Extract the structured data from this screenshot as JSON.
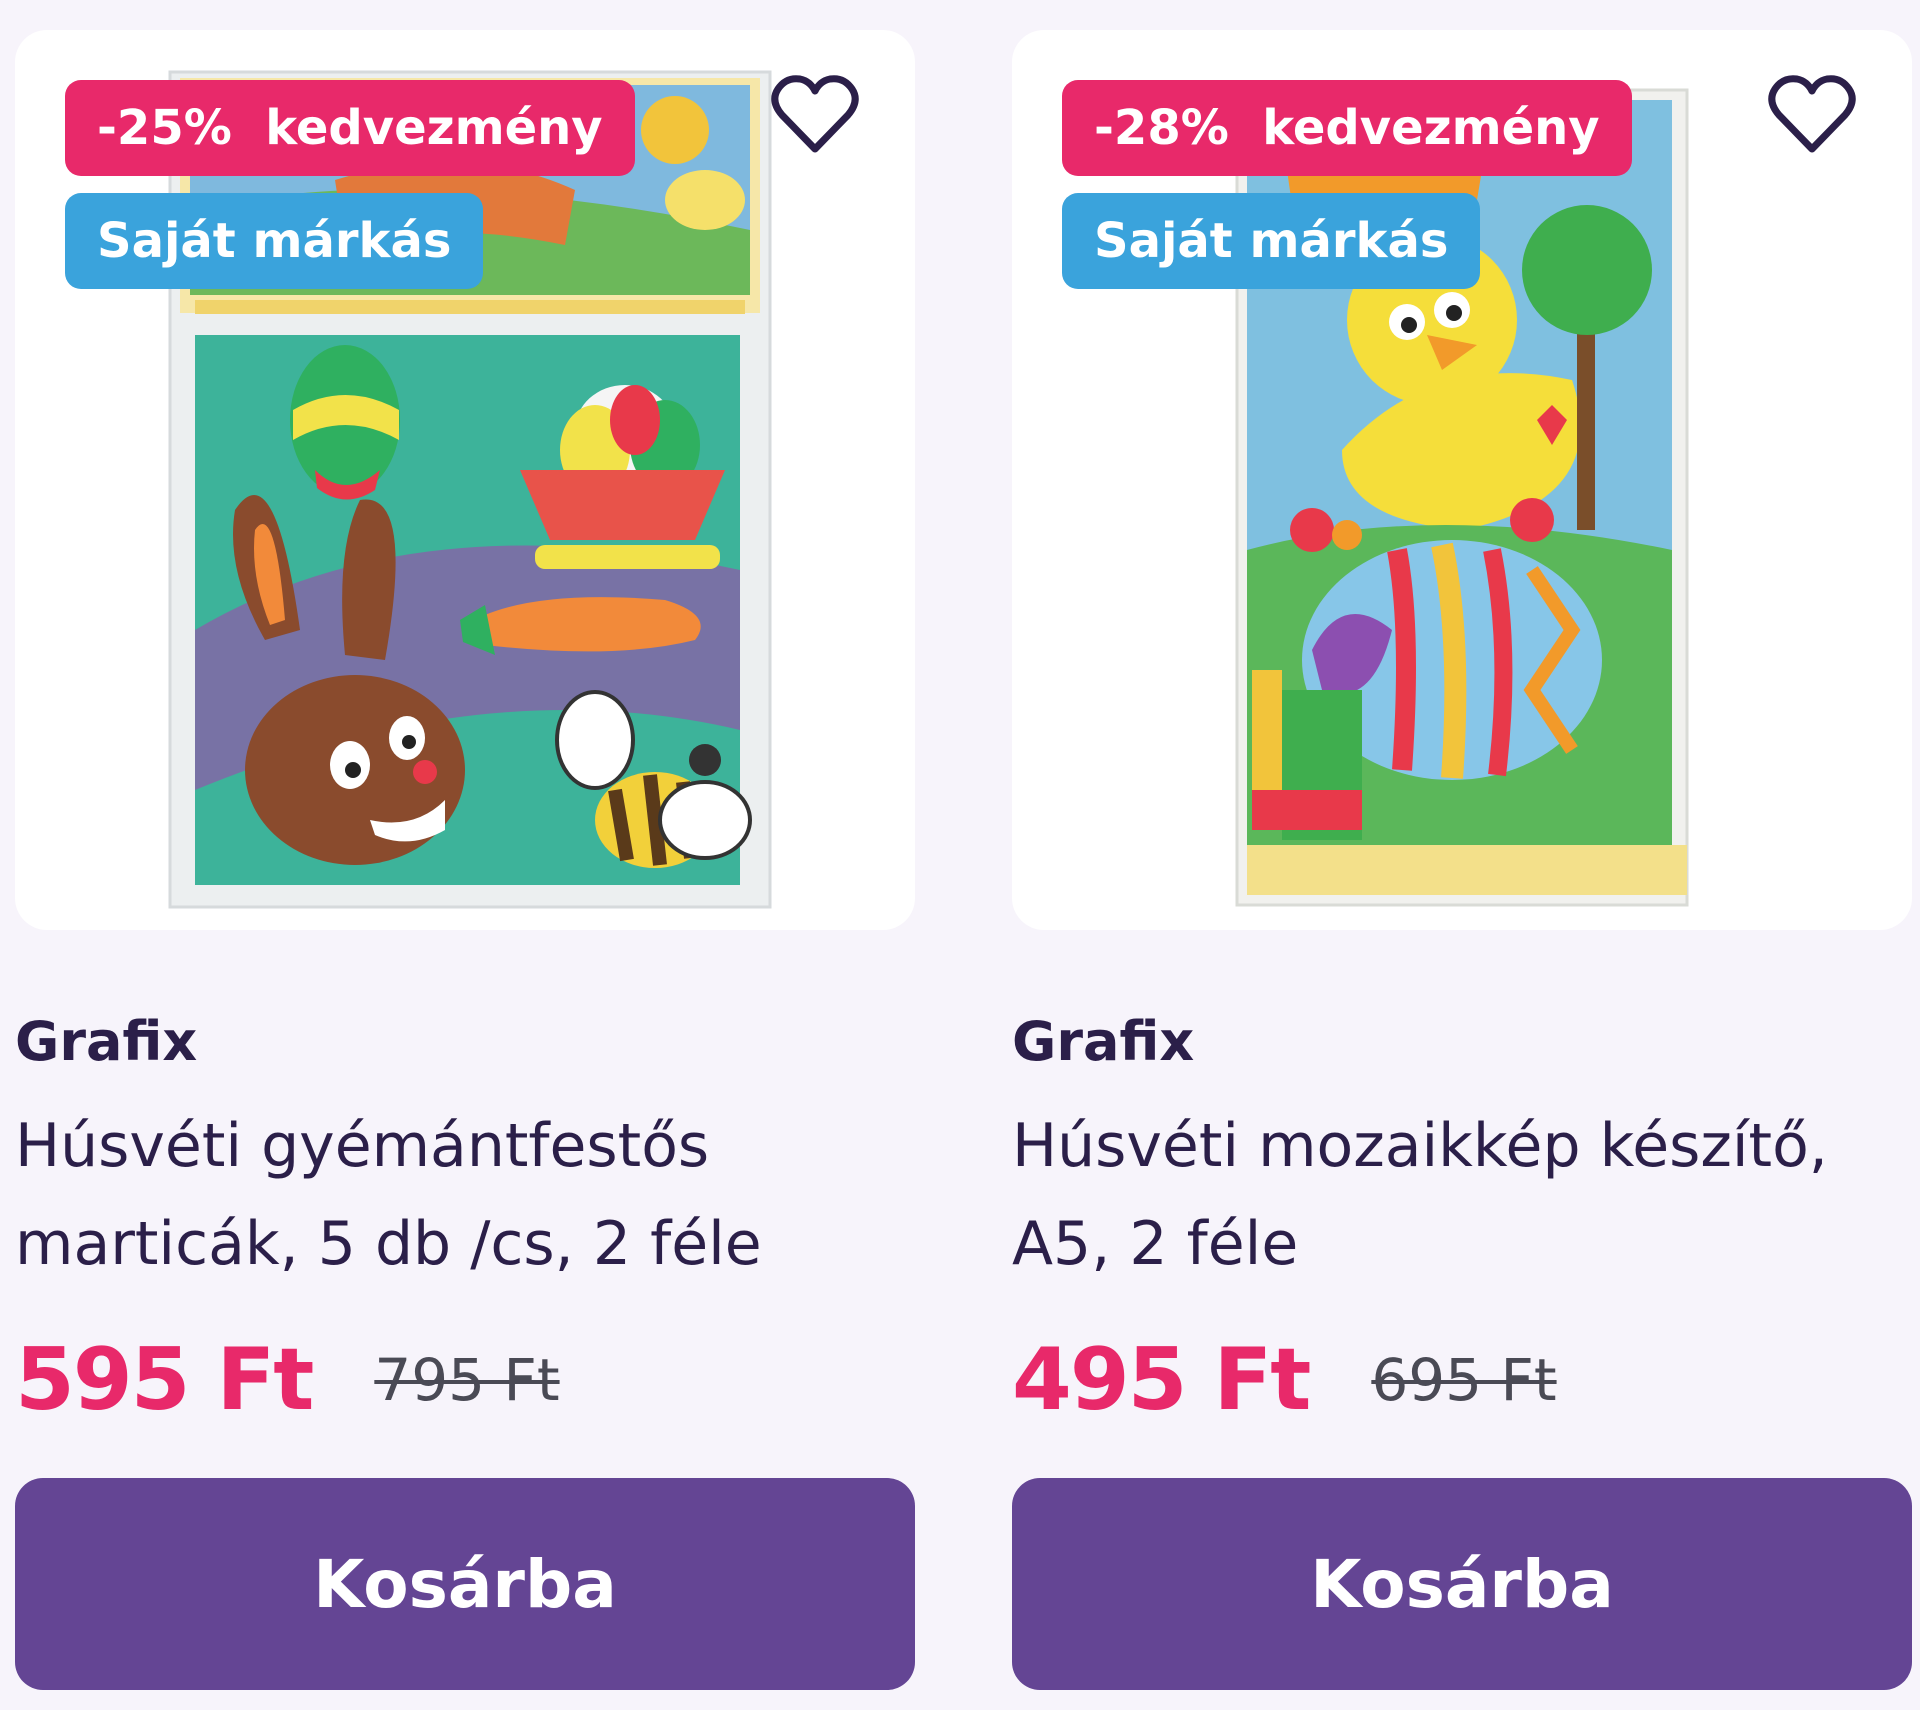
{
  "colors": {
    "background": "#f7f4fb",
    "discount_badge": "#e8296a",
    "brand_badge": "#3aa3dc",
    "price": "#e8296a",
    "cart_button": "#644594",
    "text": "#2b1f49"
  },
  "products": [
    {
      "discount_badge": "-25%  kedvezmény",
      "brand_badge": "Saját márkás",
      "wishlist_icon": "heart-outline-icon",
      "image_description_icon": "easter-diamond-painting-stickers",
      "brand": "Grafix",
      "title": "Húsvéti gyémántfestős marticák, 5 db /cs, 2 féle",
      "price": "595 Ft",
      "old_price": "795 Ft",
      "cart_label": "Kosárba"
    },
    {
      "discount_badge": "-28%  kedvezmény",
      "brand_badge": "Saját márkás",
      "wishlist_icon": "heart-outline-icon",
      "image_description_icon": "easter-mosaic-chick-kit",
      "brand": "Grafix",
      "title": "Húsvéti mozaikkép készítő, A5, 2 féle",
      "price": "495 Ft",
      "old_price": "695 Ft",
      "cart_label": "Kosárba"
    }
  ]
}
